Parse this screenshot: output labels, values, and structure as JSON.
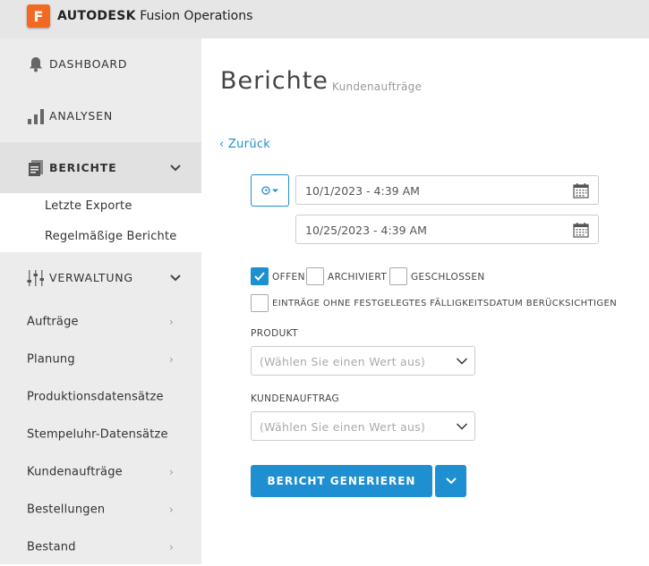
{
  "app": {
    "logo_letter": "F",
    "brand_bold": "AUTODESK",
    "brand_product": "Fusion Operations"
  },
  "sidebar": {
    "main": [
      {
        "label": "DASHBOARD",
        "icon": "bell-icon"
      },
      {
        "label": "ANALYSEN",
        "icon": "bar-chart-icon"
      },
      {
        "label": "BERICHTE",
        "icon": "report-icon"
      },
      {
        "label": "VERWALTUNG",
        "icon": "sliders-icon"
      }
    ],
    "berichte_sub": [
      "Letzte Exporte",
      "Regelmäßige Berichte"
    ],
    "verwaltung_sub": [
      "Aufträge",
      "Planung",
      "Produktionsdatensätze",
      "Stempeluhr-Datensätze",
      "Kundenaufträge",
      "Bestellungen",
      "Bestand"
    ]
  },
  "main": {
    "title": "Berichte",
    "subtitle": "Kundenaufträge",
    "back": "‹ Zurück",
    "date_from": "10/1/2023 - 4:39 AM",
    "date_to": "10/25/2023 - 4:39 AM",
    "status": {
      "offen": "OFFEN",
      "archiviert": "ARCHIVIERT",
      "geschlossen": "GESCHLOSSEN"
    },
    "include_no_due": "EINTRÄGE OHNE FESTGELEGTES FÄLLIGKEITSDATUM BERÜCKSICHTIGEN",
    "produkt_label": "PRODUKT",
    "produkt_placeholder": "(Wählen Sie einen Wert aus)",
    "kundenauftrag_label": "KUNDENAUFTRAG",
    "kundenauftrag_placeholder": "(Wählen Sie einen Wert aus)",
    "generate": "BERICHT GENERIEREN"
  },
  "colors": {
    "accent": "#1e8fd1",
    "logo": "#f26a21"
  }
}
